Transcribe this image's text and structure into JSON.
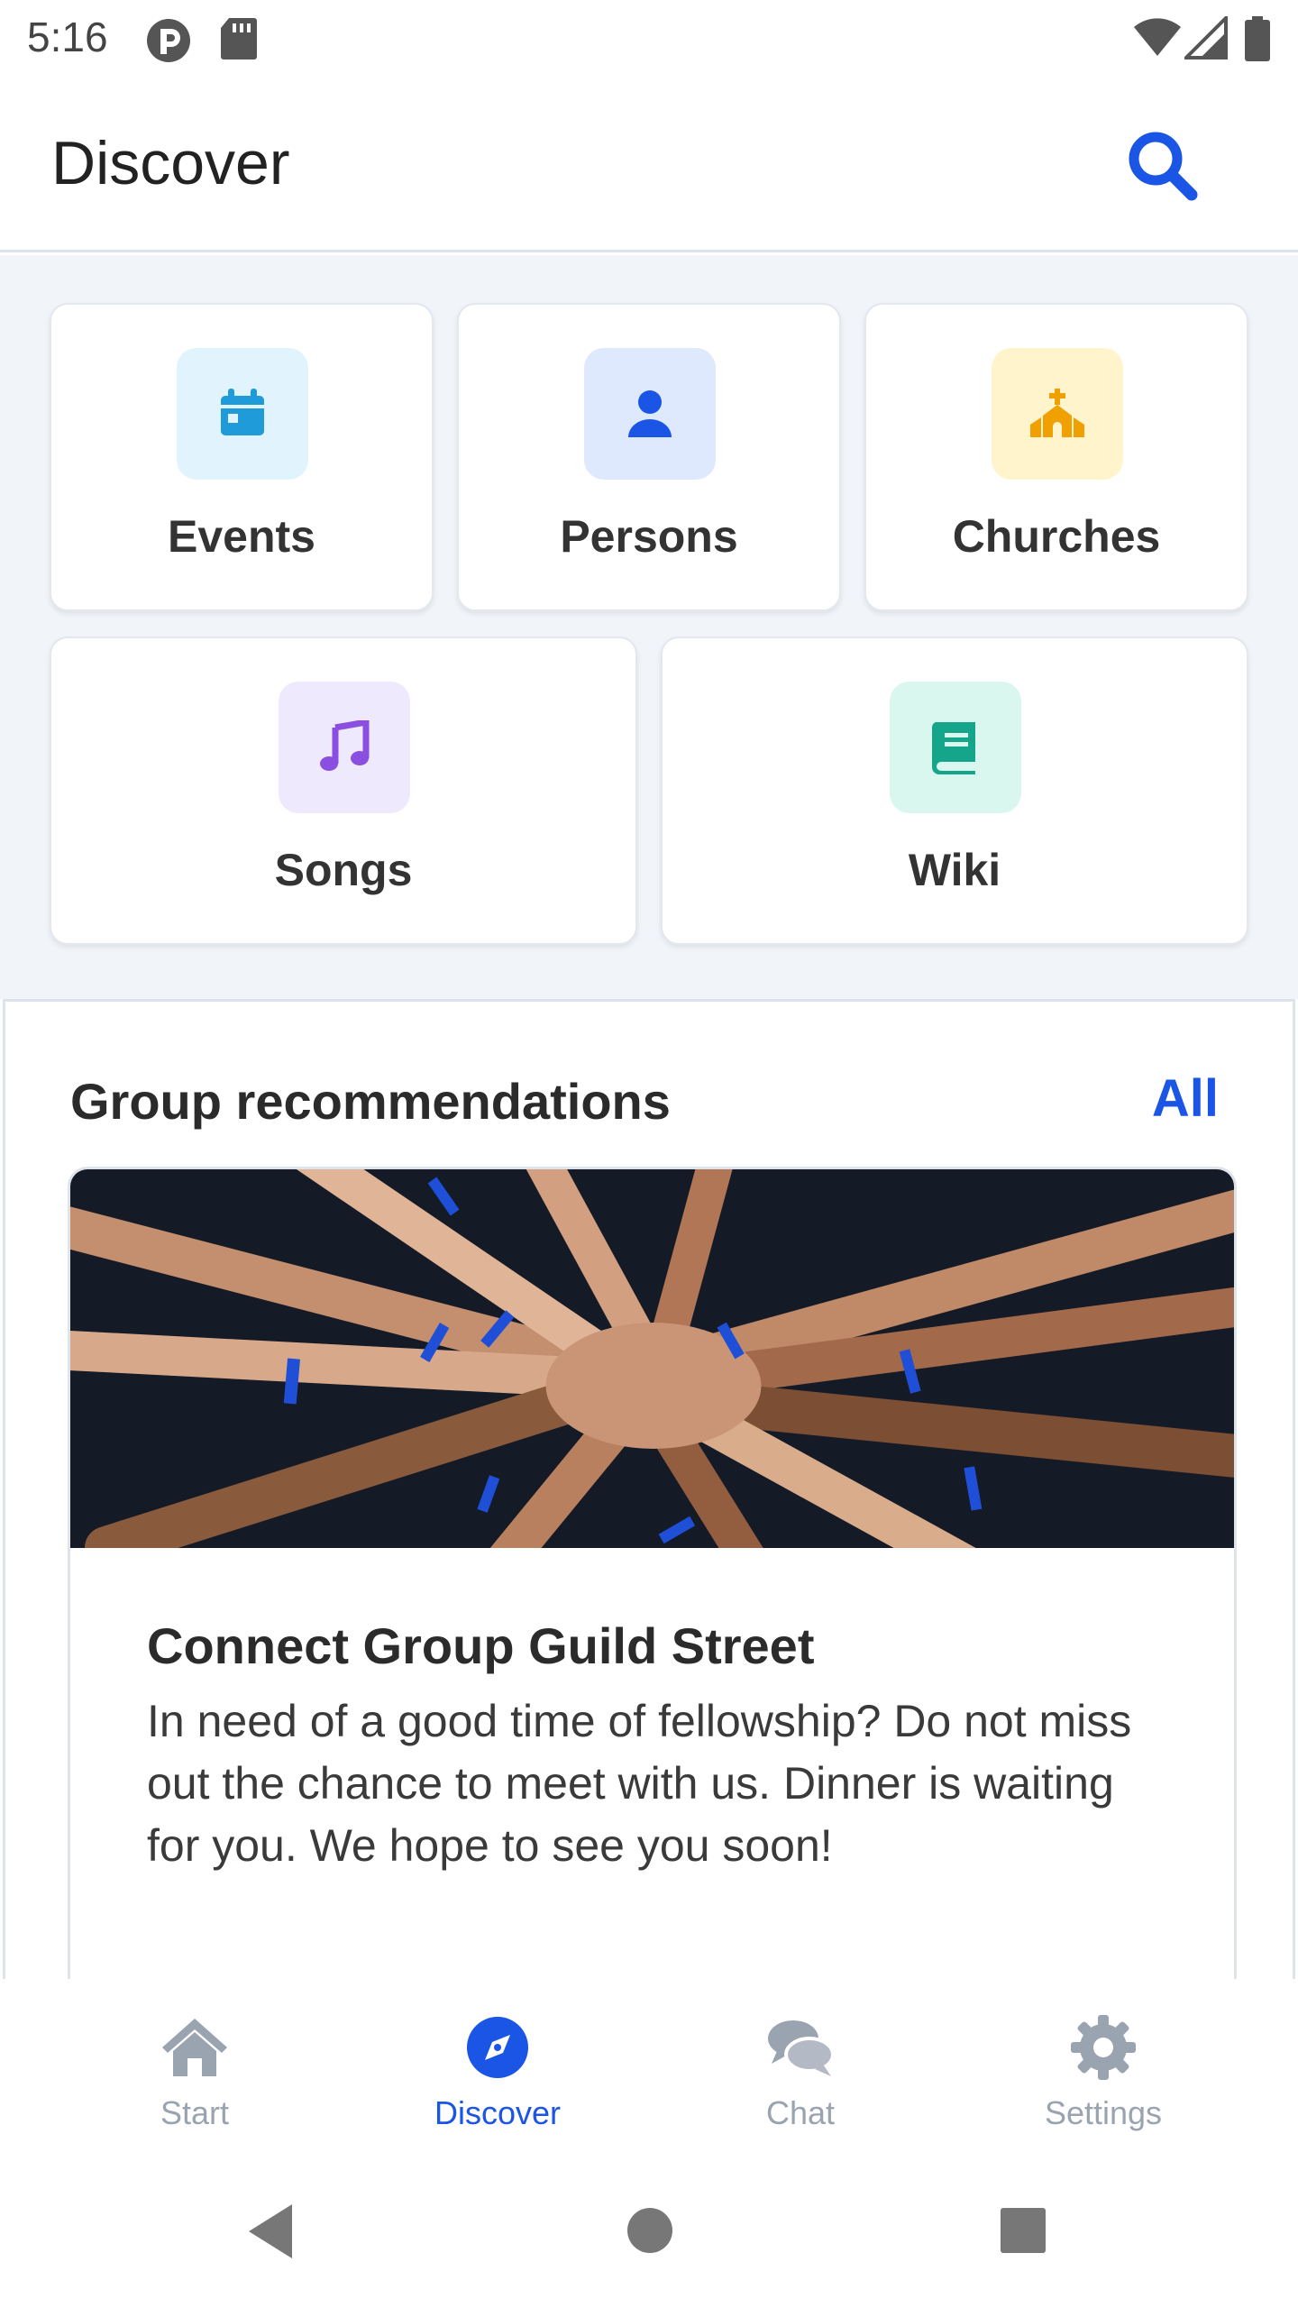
{
  "status_bar": {
    "time": "5:16"
  },
  "header": {
    "title": "Discover",
    "search_icon": "search-icon"
  },
  "categories": [
    {
      "label": "Events",
      "icon": "calendar-icon",
      "icon_color": "#1e9bd8",
      "bg_color": "#e1f3fd"
    },
    {
      "label": "Persons",
      "icon": "person-icon",
      "icon_color": "#1a55e6",
      "bg_color": "#dfe9fd"
    },
    {
      "label": "Churches",
      "icon": "church-icon",
      "icon_color": "#f0a000",
      "bg_color": "#fff4cc"
    },
    {
      "label": "Songs",
      "icon": "music-note-icon",
      "icon_color": "#8a4fe0",
      "bg_color": "#efe9fe"
    },
    {
      "label": "Wiki",
      "icon": "book-icon",
      "icon_color": "#15a58a",
      "bg_color": "#d9f7ef"
    }
  ],
  "groups": {
    "title": "Group recommendations",
    "all_link": "All",
    "card": {
      "name": "Connect Group Guild Street",
      "description": "In need of a good time of fellowship? Do not miss out the chance to meet with us. Dinner is waiting for you. We hope to see you soon!"
    }
  },
  "bottom_nav": [
    {
      "label": "Start",
      "icon": "home-icon",
      "active": false
    },
    {
      "label": "Discover",
      "icon": "compass-icon",
      "active": true
    },
    {
      "label": "Chat",
      "icon": "chat-icon",
      "active": false
    },
    {
      "label": "Settings",
      "icon": "gear-icon",
      "active": false
    }
  ],
  "colors": {
    "accent": "#1a55e6",
    "inactive": "#9aa3b0",
    "background": "#f1f4f9"
  }
}
